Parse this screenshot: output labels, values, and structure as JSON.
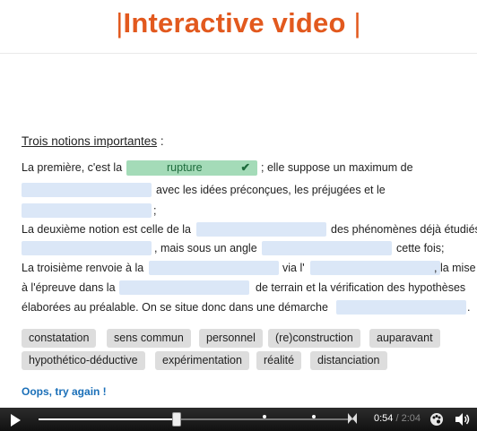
{
  "header": {
    "title": "Interactive video",
    "title_prefix": "|",
    "title_suffix": "|"
  },
  "exercise": {
    "heading": "Trois notions importantes",
    "heading_colon": " :",
    "line1_a": "La première, c'est la",
    "line1_answer": "rupture",
    "line1_b": "; elle suppose un maximum de",
    "line2": "avec les idées préconçues, les préjugées et le",
    "line3": ";",
    "line4_a": "La deuxième notion est celle de la",
    "line4_b": "des phénomènes déjà étudiés",
    "line5_a": ", mais sous un angle",
    "line5_b": "cette fois;",
    "line6_a": "La troisième renvoie à la",
    "line6_b": "via l'",
    "line6_c": ", la mise",
    "line7_a": "à l'épreuve dans la",
    "line7_b": "de terrain et la vérification des hypothèses",
    "line8_a": "élaborées au préalable. On se situe donc dans une démarche",
    "line8_b": "."
  },
  "word_bank": [
    "constatation",
    "sens commun",
    "personnel",
    "(re)construction",
    "auparavant",
    "hypothético-déductive",
    "expérimentation",
    "réalité",
    "distanciation"
  ],
  "feedback": "Oops, try again !",
  "player": {
    "current_time": "0:54",
    "separator": " / ",
    "total_time": "2:04",
    "progress_fraction": 0.43
  },
  "colors": {
    "title": "#e2591e",
    "blank": "#dbe7f7",
    "correct": "#a4dbb8",
    "chip": "#dddddd",
    "feedback": "#1a6fb8"
  },
  "icons": {
    "play": "play-icon",
    "settings": "settings-icon",
    "volume": "volume-icon",
    "check": "check-icon"
  }
}
